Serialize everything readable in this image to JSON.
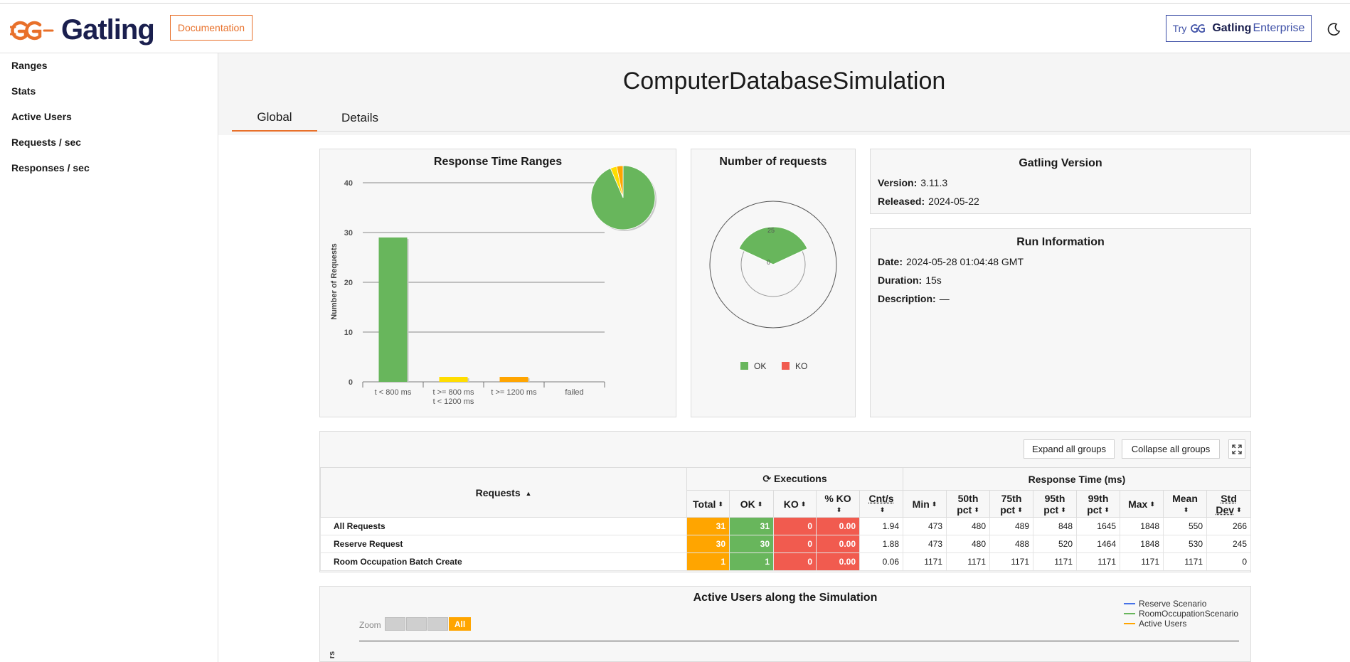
{
  "header": {
    "logo_text": "Gatling",
    "documentation_label": "Documentation",
    "try_prefix": "Try",
    "try_brand": "Gatling",
    "try_suffix": "Enterprise",
    "accent_color": "#e8702a"
  },
  "sidebar": {
    "items": [
      {
        "label": "Ranges"
      },
      {
        "label": "Stats"
      },
      {
        "label": "Active Users"
      },
      {
        "label": "Requests / sec"
      },
      {
        "label": "Responses / sec"
      }
    ]
  },
  "main": {
    "title": "ComputerDatabaseSimulation",
    "tabs": [
      {
        "label": "Global",
        "active": true
      },
      {
        "label": "Details",
        "active": false
      }
    ]
  },
  "response_time_ranges": {
    "title": "Response Time Ranges",
    "ylabel": "Number of Requests"
  },
  "number_of_requests": {
    "title": "Number of requests",
    "legend_ok": "OK",
    "legend_ko": "KO",
    "tick_25": "25",
    "tick_0": "0"
  },
  "gatling_version": {
    "title": "Gatling Version",
    "version_label": "Version:",
    "version_value": "3.11.3",
    "released_label": "Released:",
    "released_value": "2024-05-22"
  },
  "run_information": {
    "title": "Run Information",
    "date_label": "Date:",
    "date_value": "2024-05-28 01:04:48 GMT",
    "duration_label": "Duration:",
    "duration_value": "15s",
    "description_label": "Description:",
    "description_value": "—"
  },
  "stats_table": {
    "expand_label": "Expand all groups",
    "collapse_label": "Collapse all groups",
    "requests_header": "Requests",
    "executions_header": "Executions",
    "response_time_header": "Response Time (ms)",
    "col_total": "Total",
    "col_ok": "OK",
    "col_ko": "KO",
    "col_pct_ko": "% KO",
    "col_cnt": "Cnt/s",
    "col_min": "Min",
    "col_p50_a": "50th",
    "col_p50_b": "pct",
    "col_p75_a": "75th",
    "col_p75_b": "pct",
    "col_p95_a": "95th",
    "col_p95_b": "pct",
    "col_p99_a": "99th",
    "col_p99_b": "pct",
    "col_max": "Max",
    "col_mean": "Mean",
    "col_std_a": "Std",
    "col_std_b": "Dev",
    "rows": [
      {
        "name": "All Requests",
        "total": "31",
        "ok": "31",
        "ko": "0",
        "pct_ko": "0.00",
        "cnt": "1.94",
        "min": "473",
        "p50": "480",
        "p75": "489",
        "p95": "848",
        "p99": "1645",
        "max": "1848",
        "mean": "550",
        "std": "266"
      },
      {
        "name": "Reserve Request",
        "total": "30",
        "ok": "30",
        "ko": "0",
        "pct_ko": "0.00",
        "cnt": "1.88",
        "min": "473",
        "p50": "480",
        "p75": "488",
        "p95": "520",
        "p99": "1464",
        "max": "1848",
        "mean": "530",
        "std": "245"
      },
      {
        "name": "Room Occupation Batch Create",
        "total": "1",
        "ok": "1",
        "ko": "0",
        "pct_ko": "0.00",
        "cnt": "0.06",
        "min": "1171",
        "p50": "1171",
        "p75": "1171",
        "p95": "1171",
        "p99": "1171",
        "max": "1171",
        "mean": "1171",
        "std": "0"
      }
    ]
  },
  "active_users": {
    "title": "Active Users along the Simulation",
    "zoom_label": "Zoom",
    "zoom_all": "All",
    "ylabel_fragment": "rs",
    "legend": [
      {
        "label": "Reserve Scenario",
        "color": "#4572e8"
      },
      {
        "label": "RoomOccupationScenario",
        "color": "#68b65c"
      },
      {
        "label": "Active Users",
        "color": "#ffa500"
      }
    ]
  },
  "chart_data": [
    {
      "type": "bar",
      "title": "Response Time Ranges",
      "ylabel": "Number of Requests",
      "categories": [
        "t < 800 ms",
        "t >= 800 ms\nt < 1200 ms",
        "t >= 1200 ms",
        "failed"
      ],
      "category_lines": [
        [
          "t < 800 ms"
        ],
        [
          "t >= 800 ms",
          "t < 1200 ms"
        ],
        [
          "t >= 1200 ms"
        ],
        [
          "failed"
        ]
      ],
      "values": [
        29,
        1,
        1,
        0
      ],
      "colors": [
        "#68b65c",
        "#ffdd00",
        "#ffa500",
        "#f15b4f"
      ],
      "yticks": [
        0,
        10,
        20,
        30,
        40
      ],
      "ylim": [
        0,
        40
      ],
      "inset_pie": {
        "values": [
          29,
          1,
          1,
          0
        ],
        "colors": [
          "#68b65c",
          "#ffdd00",
          "#ffa500",
          "#f15b4f"
        ]
      }
    },
    {
      "type": "pie",
      "title": "Number of requests",
      "series": [
        {
          "name": "OK",
          "value": 31,
          "color": "#68b65c"
        },
        {
          "name": "KO",
          "value": 0,
          "color": "#f15b4f"
        }
      ]
    }
  ]
}
